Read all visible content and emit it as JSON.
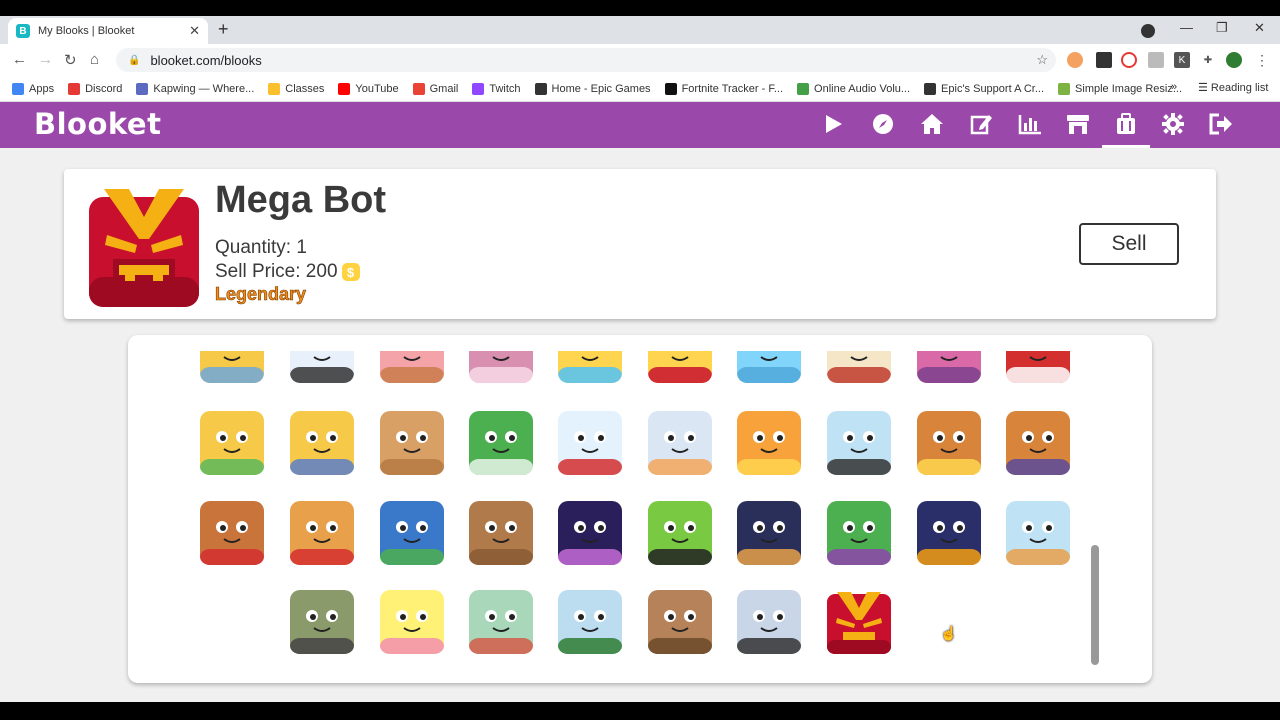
{
  "browser": {
    "tab_title": "My Blooks | Blooket",
    "tab_favicon": "B",
    "url": "blooket.com/blooks",
    "bookmarks": [
      {
        "label": "Apps",
        "color": "#4285f4"
      },
      {
        "label": "Discord",
        "color": "#e53935"
      },
      {
        "label": "Kapwing — Where...",
        "color": "#5c6bc0"
      },
      {
        "label": "Classes",
        "color": "#fbc02d"
      },
      {
        "label": "YouTube",
        "color": "#ff0000"
      },
      {
        "label": "Gmail",
        "color": "#ea4335"
      },
      {
        "label": "Twitch",
        "color": "#9146ff"
      },
      {
        "label": "Home - Epic Games",
        "color": "#333333"
      },
      {
        "label": "Fortnite Tracker - F...",
        "color": "#111111"
      },
      {
        "label": "Online Audio Volu...",
        "color": "#43a047"
      },
      {
        "label": "Epic's Support A Cr...",
        "color": "#333333"
      },
      {
        "label": "Simple Image Resiz...",
        "color": "#7cb342"
      }
    ],
    "bookmarks_more": "»",
    "reading_list": "Reading list"
  },
  "app": {
    "logo": "Blooket",
    "brand_color": "#9a49aa",
    "nav_icons": [
      "play-icon",
      "compass-icon",
      "home-icon",
      "edit-icon",
      "stats-icon",
      "market-icon",
      "blooks-icon",
      "settings-icon",
      "logout-icon"
    ]
  },
  "selected_blook": {
    "name": "Mega Bot",
    "quantity": "Quantity: 1",
    "sell_price": "Sell Price: 200",
    "rarity": "Legendary",
    "sell_label": "Sell"
  },
  "blooks_row1_partial": [
    "bear-blook",
    "card-blook",
    "cake-blook",
    "box-blook",
    "cat-blook",
    "red-blook",
    "teapot-blook",
    "owl-blook",
    "cheshire-blook",
    "mushroom-blook"
  ],
  "blooks_row2": [
    "pirate-blook",
    "king-blook",
    "toast-blook",
    "cereal-blook",
    "yogurt-blook",
    "breakfast-blook",
    "orange-juice-blook",
    "milk-blook",
    "waffle-blook",
    "pancakes-blook"
  ],
  "blooks_row3": [
    "french-toast-blook",
    "pizza-blook",
    "earth-blook",
    "meteor-blook",
    "stars-blook",
    "alien-blook",
    "planet-blook",
    "ufo-blook",
    "spaceship-blook",
    "lil-bot-blook"
  ],
  "blooks_row4": [
    "lovely-bot-blook",
    "angry-bot-blook",
    "happy-bot-blook",
    "watson-blook",
    "buddy-bot-blook",
    "brainy-bot-blook",
    "mega-bot-blook"
  ]
}
